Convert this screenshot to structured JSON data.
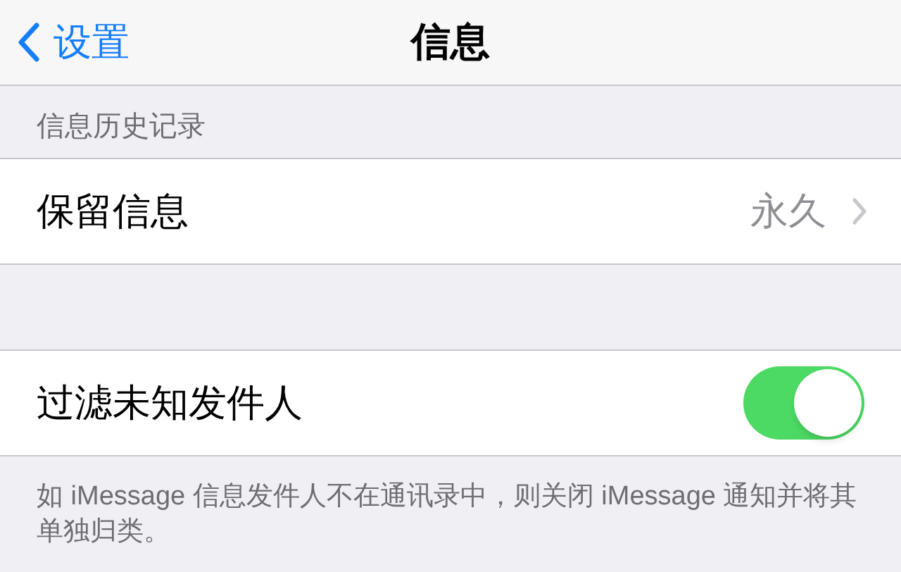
{
  "nav": {
    "back": "设置",
    "title": "信息"
  },
  "section_header": "信息历史记录",
  "keep_row": {
    "label": "保留信息",
    "value": "永久"
  },
  "filter_row": {
    "label": "过滤未知发件人",
    "on": true
  },
  "footer": "如 iMessage 信息发件人不在通讯录中，则关闭 iMessage 通知并将其单独归类。"
}
